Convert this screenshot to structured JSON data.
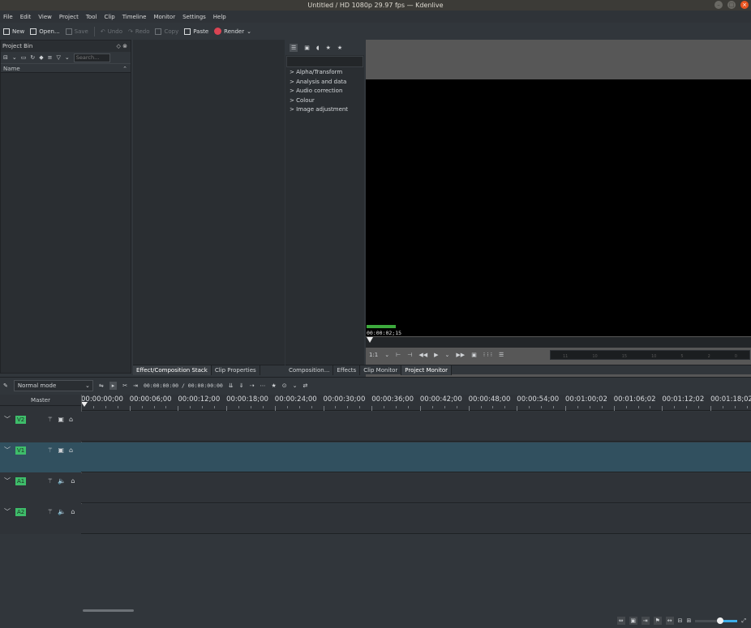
{
  "window": {
    "title": "Untitled / HD 1080p 29.97 fps — Kdenlive"
  },
  "menu": [
    "File",
    "Edit",
    "View",
    "Project",
    "Tool",
    "Clip",
    "Timeline",
    "Monitor",
    "Settings",
    "Help"
  ],
  "toolbar": {
    "new": "New",
    "open": "Open...",
    "save": "Save",
    "undo": "Undo",
    "redo": "Redo",
    "copy": "Copy",
    "paste": "Paste",
    "render": "Render"
  },
  "bin": {
    "title": "Project Bin",
    "search_placeholder": "Search...",
    "column": "Name"
  },
  "effects": {
    "categories": [
      "Alpha/Transform",
      "Analysis and data",
      "Audio correction",
      "Colour",
      "Image adjustment"
    ]
  },
  "monitor": {
    "timecode": "00:00:02;15",
    "zoom": "1:1",
    "scale_labels": [
      "11",
      "10",
      "15",
      "10",
      "5",
      "2",
      "0"
    ]
  },
  "tabs_left": [
    "Effect/Composition Stack",
    "Clip Properties"
  ],
  "tabs_right": [
    "Composition...",
    "Effects",
    "Clip Monitor",
    "Project Monitor"
  ],
  "timeline": {
    "mode": "Normal mode",
    "timecode": "00:00:00:00 / 00:00:00:00",
    "master": "Master",
    "ruler": [
      "00:00:00;00",
      "00:00:06;00",
      "00:00:12;00",
      "00:00:18;00",
      "00:00:24;00",
      "00:00:30;00",
      "00:00:36;00",
      "00:00:42;00",
      "00:00:48;00",
      "00:00:54;00",
      "00:01:00;02",
      "00:01:06;02",
      "00:01:12;02",
      "00:01:18;02"
    ],
    "tracks": [
      {
        "name": "V2",
        "kind": "video"
      },
      {
        "name": "V1",
        "kind": "video",
        "selected": true
      },
      {
        "name": "A1",
        "kind": "audio"
      },
      {
        "name": "A2",
        "kind": "audio"
      }
    ]
  },
  "colors": {
    "accent": "#3daee9",
    "track_badge": "#3ebd6a",
    "selected_track": "#31505f",
    "record": "#da4453"
  }
}
